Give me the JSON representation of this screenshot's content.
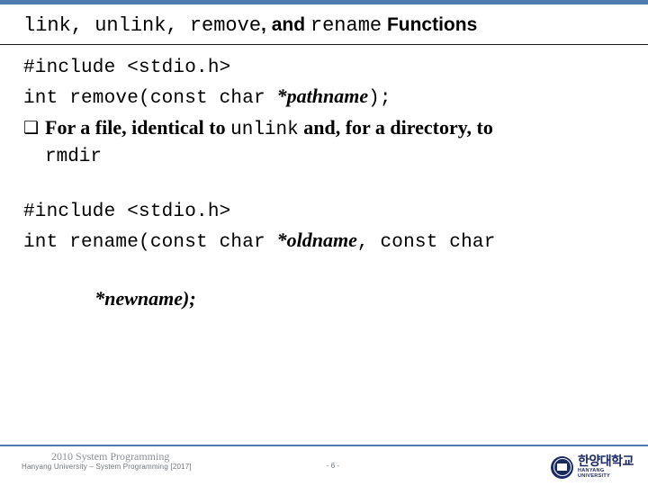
{
  "colors": {
    "accent_bar": "#4f7ab0",
    "title_rule": "#1a1a1a",
    "footer_rule": "#4f7ab0",
    "logo_navy": "#1b2a63",
    "footer_text": "#6d7378",
    "footer_title_text": "#8a8f96"
  },
  "title": {
    "part1_mono": "link, unlink, remove",
    "part2_sans": ", and ",
    "part3_mono": "rename",
    "part4_sans": " Functions"
  },
  "body": {
    "block1": {
      "line1": "#include <stdio.h>",
      "line2_pre": "int remove(const char ",
      "line2_param": "*pathname",
      "line2_post": ");",
      "bullet_glyph": "❑",
      "bullet_text_pre": "For a file, identical to ",
      "bullet_mono_1": "unlink",
      "bullet_text_mid": " and, for a directory, to",
      "bullet_mono_2": "rmdir"
    },
    "block2": {
      "line1": "#include <stdio.h>",
      "line2_pre": "int rename(const char ",
      "line2_param1": "*oldname",
      "line2_mid": ", const char",
      "line3_param2": "*newname",
      "line3_post": ");"
    }
  },
  "footer": {
    "course_title": "2010 System Programming",
    "subtitle": "Hanyang University – System Programming [2017]",
    "page_number": "- 6 -",
    "logo_korean": "한양대학교",
    "logo_english": "HANYANG UNIVERSITY"
  }
}
